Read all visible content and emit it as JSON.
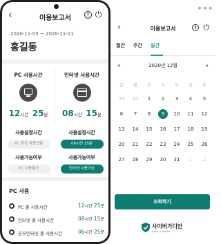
{
  "phone": {
    "title": "이용보고서",
    "back_icon": "chevron-left-icon",
    "info_icon": "info-circle-icon",
    "power_icon": "power-icon",
    "date_range": "2020-11-05 ~ 2020-11-11",
    "user_name": "홍길동",
    "pc_time": {
      "label": "PC 사용시간",
      "hours": "12",
      "hours_unit": "시간",
      "minutes": "25",
      "minutes_unit": "분",
      "icon": "monitor-icon"
    },
    "internet_time": {
      "label": "인터넷 사용시간",
      "hours": "08",
      "hours_unit": "시간",
      "minutes": "15",
      "minutes_unit": "분",
      "icon": "browser-icon"
    },
    "pc_setting": {
      "label": "사용설정시간",
      "value": "PC 항상 사용안함"
    },
    "internet_setting": {
      "label": "사용설정시간",
      "value": "08시간 15분"
    },
    "pc_allowed": {
      "label": "사용가능여부",
      "value": "PC 사용불가"
    },
    "internet_allowed": {
      "label": "사용가능여부",
      "value": "인터넷 사용가능"
    },
    "section_title": "PC 사용",
    "usage_rows": [
      {
        "label": "PC 총 사용시간",
        "hours": "12",
        "minutes": "25"
      },
      {
        "label": "인터넷 총 사용시간",
        "hours": "08",
        "minutes": "15"
      },
      {
        "label": "공부인터넷 총 사용시간",
        "hours": "06",
        "minutes": "25"
      }
    ],
    "hours_unit": "시간",
    "minutes_unit": "분"
  },
  "calendar": {
    "window_controls": "● ● ●",
    "title": "이용보고서",
    "tabs": [
      {
        "label": "월간",
        "active": false
      },
      {
        "label": "주간",
        "active": false
      },
      {
        "label": "일간",
        "active": true
      }
    ],
    "month_label": "2020년 12월",
    "weekdays": [
      "일",
      "월",
      "화",
      "수",
      "목",
      "금",
      "토"
    ],
    "weeks": [
      [
        {
          "d": "29",
          "m": true
        },
        {
          "d": "30",
          "m": true
        },
        {
          "d": "1"
        },
        {
          "d": "2"
        },
        {
          "d": "3"
        },
        {
          "d": "4"
        },
        {
          "d": "5"
        }
      ],
      [
        {
          "d": "6"
        },
        {
          "d": "7"
        },
        {
          "d": "8"
        },
        {
          "d": "9",
          "sel": true
        },
        {
          "d": "10"
        },
        {
          "d": "11"
        },
        {
          "d": "12"
        }
      ],
      [
        {
          "d": "13"
        },
        {
          "d": "14"
        },
        {
          "d": "15"
        },
        {
          "d": "16"
        },
        {
          "d": "17"
        },
        {
          "d": "18"
        },
        {
          "d": "19"
        }
      ],
      [
        {
          "d": "20"
        },
        {
          "d": "21"
        },
        {
          "d": "22"
        },
        {
          "d": "23"
        },
        {
          "d": "24"
        },
        {
          "d": "25"
        },
        {
          "d": "26"
        }
      ],
      [
        {
          "d": "27"
        },
        {
          "d": "28"
        },
        {
          "d": "29"
        },
        {
          "d": "30"
        },
        {
          "d": "31"
        },
        {
          "d": "1",
          "m": true
        },
        {
          "d": "2",
          "m": true
        }
      ]
    ],
    "search_button": "조회하기",
    "logo_text": "사이버가디언",
    "logo_sub": "cyber Guardian",
    "accent_color": "#0d7d72"
  }
}
